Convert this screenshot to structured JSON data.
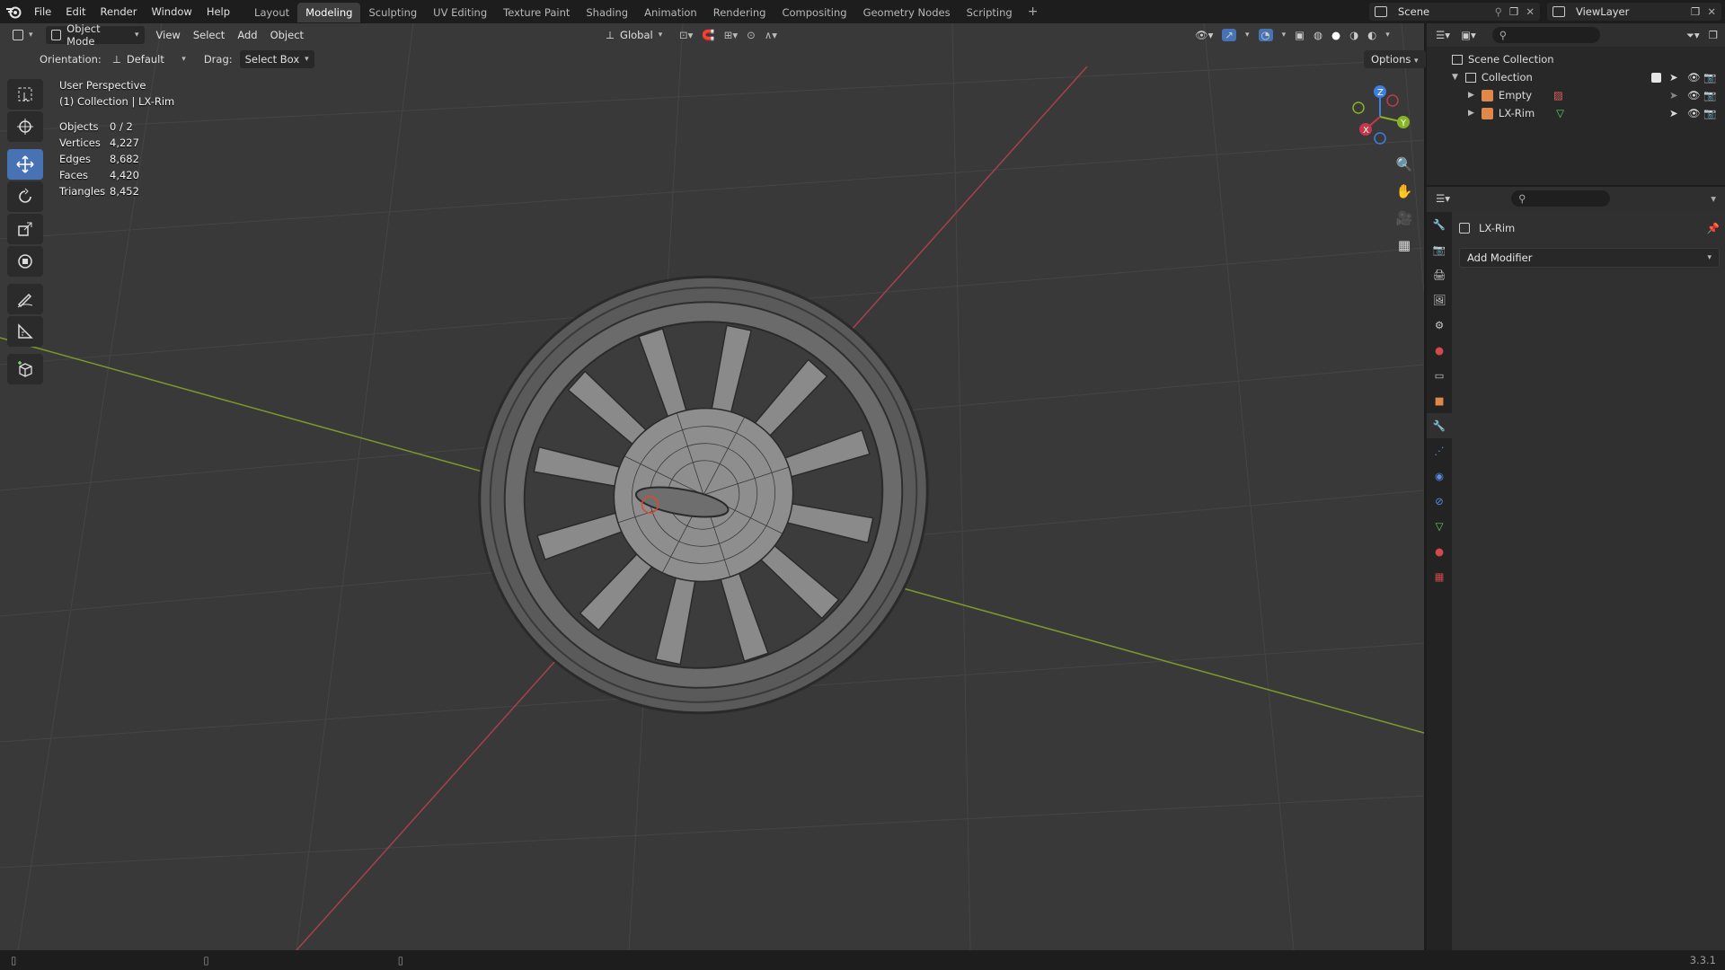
{
  "menu": {
    "file": "File",
    "edit": "Edit",
    "render": "Render",
    "window": "Window",
    "help": "Help"
  },
  "workspaces": [
    "Layout",
    "Modeling",
    "Sculpting",
    "UV Editing",
    "Texture Paint",
    "Shading",
    "Animation",
    "Rendering",
    "Compositing",
    "Geometry Nodes",
    "Scripting"
  ],
  "workspace_add": "+",
  "scene": {
    "name": "Scene"
  },
  "view_layer": {
    "name": "ViewLayer"
  },
  "viewport_header": {
    "mode": "Object Mode",
    "view": "View",
    "select": "Select",
    "add": "Add",
    "object": "Object",
    "transform_orientation": "Global"
  },
  "tool_settings": {
    "orientation_label": "Orientation:",
    "orientation_value": "Default",
    "drag_label": "Drag:",
    "drag_value": "Select Box",
    "options": "Options"
  },
  "overlay": {
    "perspective": "User Perspective",
    "context": "(1) Collection | LX-Rim",
    "stats": [
      {
        "key": "Objects",
        "value": "0 / 2"
      },
      {
        "key": "Vertices",
        "value": "4,227"
      },
      {
        "key": "Edges",
        "value": "8,682"
      },
      {
        "key": "Faces",
        "value": "4,420"
      },
      {
        "key": "Triangles",
        "value": "8,452"
      }
    ]
  },
  "outliner": {
    "scene_collection": "Scene Collection",
    "collection": "Collection",
    "items": [
      {
        "name": "Empty"
      },
      {
        "name": "LX-Rim"
      }
    ]
  },
  "properties": {
    "object_name": "LX-Rim",
    "add_modifier": "Add Modifier"
  },
  "version": "3.3.1",
  "colors": {
    "accent": "#4772b3",
    "x_axis": "#c4384a",
    "y_axis": "#86b524",
    "z_axis": "#3d7fe0",
    "viewport_bg": "#393939"
  }
}
